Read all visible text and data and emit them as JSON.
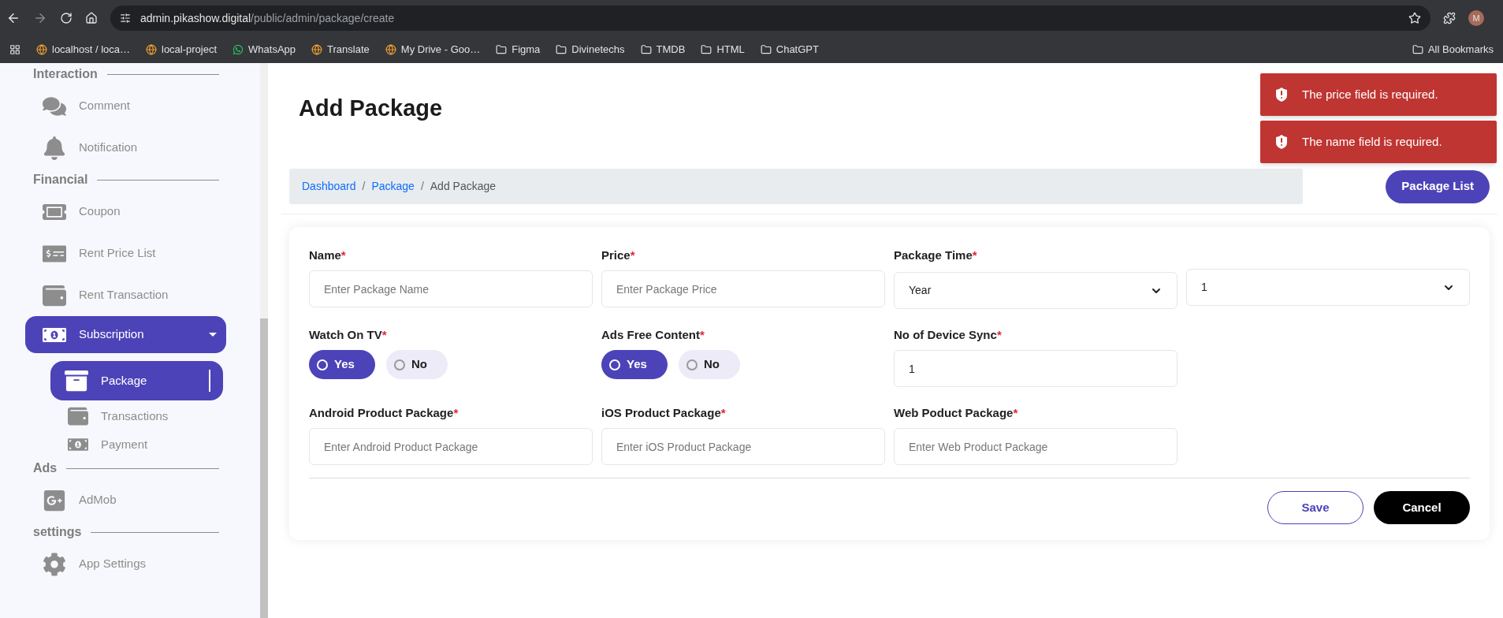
{
  "browser": {
    "url_host": "admin.pikashow.digital",
    "url_path": "/public/admin/package/create",
    "profile": "M",
    "bookmarks": [
      "localhost / loca…",
      "local-project",
      "WhatsApp",
      "Translate",
      "My Drive - Goo…",
      "Figma",
      "Divinetechs",
      "TMDB",
      "HTML",
      "ChatGPT"
    ],
    "all_bookmarks": "All Bookmarks"
  },
  "sidebar": {
    "sections": [
      {
        "title": "Interaction",
        "items": [
          {
            "label": "Comment",
            "selected": false
          },
          {
            "label": "Notification",
            "selected": false
          }
        ]
      },
      {
        "title": "Financial",
        "items": [
          {
            "label": "Coupon",
            "selected": false
          },
          {
            "label": "Rent Price List",
            "selected": false
          },
          {
            "label": "Rent Transaction",
            "selected": false
          },
          {
            "label": "Subscription",
            "selected": true,
            "expanded": true,
            "children": [
              {
                "label": "Package",
                "selected": true
              },
              {
                "label": "Transactions",
                "selected": false
              },
              {
                "label": "Payment",
                "selected": false
              }
            ]
          }
        ]
      },
      {
        "title": "Ads",
        "items": [
          {
            "label": "AdMob",
            "selected": false
          }
        ]
      },
      {
        "title": "settings",
        "items": [
          {
            "label": "App Settings",
            "selected": false
          }
        ]
      }
    ]
  },
  "page": {
    "title": "Add Package",
    "separator": "/",
    "breadcrumb": [
      {
        "label": "Dashboard",
        "link": true
      },
      {
        "label": "Package",
        "link": true
      },
      {
        "label": "Add Package",
        "link": false
      }
    ],
    "list_button": "Package List"
  },
  "toasts": [
    "The price field is required.",
    "The name field is required."
  ],
  "form": {
    "required_mark": "*",
    "fields": [
      {
        "kind": "text",
        "label": "Name",
        "required": true,
        "placeholder": "Enter Package Name"
      },
      {
        "kind": "text",
        "label": "Price",
        "required": true,
        "placeholder": "Enter Package Price"
      },
      {
        "kind": "select",
        "label": "Package Time",
        "required": true,
        "values": [
          "Year",
          "1"
        ]
      },
      {
        "kind": "radio",
        "label": "Watch On TV",
        "required": true,
        "options": [
          {
            "label": "Yes",
            "selected": true
          },
          {
            "label": "No",
            "selected": false
          }
        ]
      },
      {
        "kind": "radio",
        "label": "Ads Free Content",
        "required": true,
        "options": [
          {
            "label": "Yes",
            "selected": true
          },
          {
            "label": "No",
            "selected": false
          }
        ]
      },
      {
        "kind": "text",
        "label": "No of Device Sync",
        "required": true,
        "value": "1"
      },
      {
        "kind": "break"
      },
      {
        "kind": "text",
        "label": "Android Product Package",
        "required": true,
        "placeholder": "Enter Android Product Package"
      },
      {
        "kind": "text",
        "label": "iOS Product Package",
        "required": true,
        "placeholder": "Enter iOS Product Package"
      },
      {
        "kind": "text",
        "label": "Web Poduct Package",
        "required": true,
        "placeholder": "Enter Web Product Package"
      }
    ],
    "save": "Save",
    "cancel": "Cancel"
  }
}
